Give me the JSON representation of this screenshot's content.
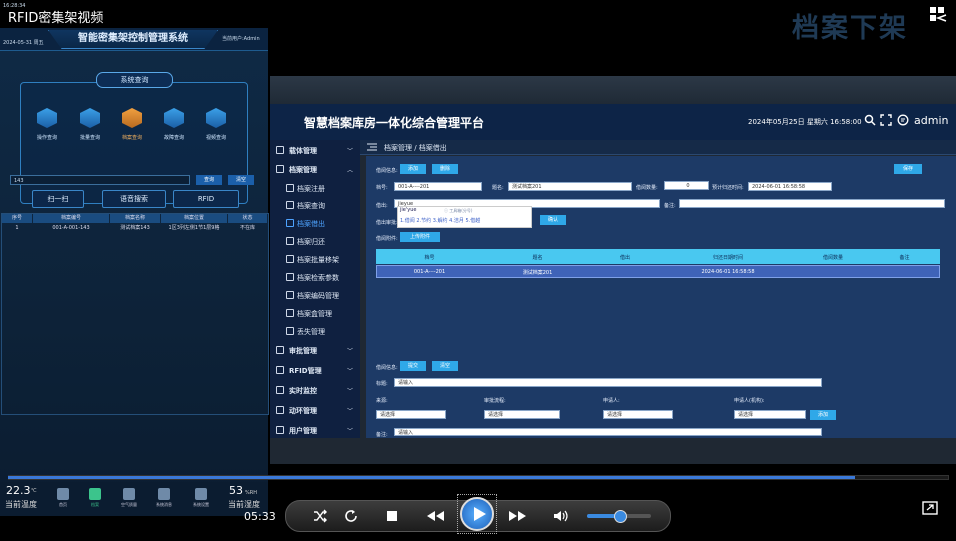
{
  "player": {
    "title": "RFID密集架视频",
    "corner_caption": "档案下架",
    "elapsed": "05:33",
    "progress": 0.9,
    "volume": 0.45
  },
  "kiosk": {
    "time": "16:28:34",
    "date": "2024-05-31 周五",
    "title": "智能密集架控制管理系统",
    "user": "当前用户:Admin",
    "query_title": "系统查询",
    "categories": [
      "操作查询",
      "批量查询",
      "档案查询",
      "故障查询",
      "视频查询"
    ],
    "active_category": 2,
    "search_value": "143",
    "query_button": "查询",
    "clear_button": "清空",
    "modes": [
      "扫一扫",
      "语音搜索",
      "RFID"
    ],
    "table_headers": [
      "序号",
      "档案编号",
      "档案名称",
      "档案位置",
      "状态"
    ],
    "table_rows": [
      [
        "1",
        "001-A-001-143",
        "测试档案143",
        "1区3列左侧1节1层9格",
        "不在库"
      ]
    ],
    "temp_value": "22.3",
    "temp_unit": "℃",
    "temp_label": "当前温度",
    "hum_value": "53",
    "hum_unit": "%RH",
    "hum_label": "当前湿度",
    "nav": [
      "首页",
      "档案",
      "空气质量",
      "系统消息",
      "系统设置"
    ],
    "nav_active": 1
  },
  "app": {
    "title": "智慧档案库房一体化综合管理平台",
    "datetime": "2024年05月25日 星期六 16:58:00",
    "user": "admin",
    "breadcrumb": "档案管理 / 档案借出",
    "sidebar": [
      {
        "label": "载体管理",
        "main": true
      },
      {
        "label": "档案管理",
        "main": true
      },
      {
        "label": "档案注册",
        "main": false
      },
      {
        "label": "档案查询",
        "main": false
      },
      {
        "label": "档案借出",
        "main": false,
        "active": true
      },
      {
        "label": "档案归还",
        "main": false
      },
      {
        "label": "档案批量移架",
        "main": false
      },
      {
        "label": "档案检索参数",
        "main": false
      },
      {
        "label": "档案编码管理",
        "main": false
      },
      {
        "label": "档案盒管理",
        "main": false
      },
      {
        "label": "丢失管理",
        "main": false
      },
      {
        "label": "审批管理",
        "main": true
      },
      {
        "label": "RFID管理",
        "main": true
      },
      {
        "label": "实时监控",
        "main": true
      },
      {
        "label": "动环管理",
        "main": true
      },
      {
        "label": "用户管理",
        "main": true
      }
    ],
    "form": {
      "info_label": "借阅信息:",
      "add_button": "添加",
      "delete_button": "删除",
      "save_button": "保存",
      "code_label": "档号:",
      "code_value": "001-A----201",
      "name_label": "题名:",
      "name_value": "测试档案201",
      "count_label": "借阅数量:",
      "count_value": "0",
      "return_label": "预计归还时间:",
      "return_value": "2024-06-01 16:58:58",
      "borrower_label": "借出:",
      "borrower_value": "jieyue",
      "remark_label": "备注:",
      "approval_label": "借出审批:",
      "approval_button": "确认",
      "file_label": "借阅附件:",
      "upload_button": "上传附件",
      "ime_text": "jie'yue",
      "ime_hint": "ⓘ 工具箱(分号)",
      "ime_candidates": "1.借阅 2.节约 3.解约 4.洁月 5.借越"
    },
    "table_headers": [
      "档号",
      "题名",
      "借出",
      "归还日期时间",
      "借阅数量",
      "备注"
    ],
    "table_row": [
      "001-A----201",
      "测试档案201",
      "",
      "2024-06-01 16:58:58",
      "",
      ""
    ],
    "form2": {
      "info_label": "借阅信息:",
      "submit_button": "提交",
      "clear_button": "清空",
      "title_label": "标题:",
      "title_placeholder": "请输入",
      "source_label": "来源:",
      "source_placeholder": "请选择",
      "flow_label": "审批流程:",
      "flow_placeholder": "请选择",
      "applicant_label": "申请人:",
      "applicant_placeholder": "请选择",
      "reviewer_label": "申请人(机构):",
      "reviewer_placeholder": "请选择",
      "add_button": "添加",
      "remark_label": "备注:",
      "remark_placeholder": "请输入"
    }
  }
}
